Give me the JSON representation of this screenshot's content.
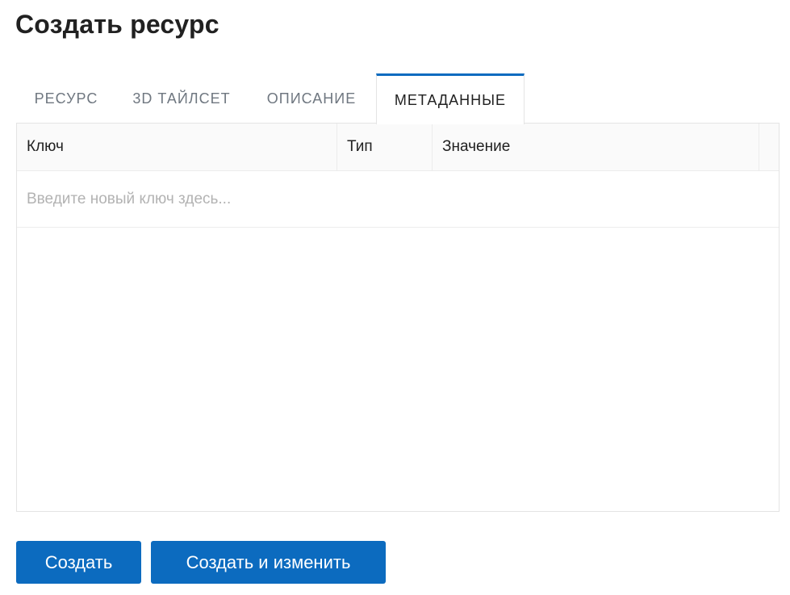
{
  "page": {
    "title": "Создать ресурс"
  },
  "tabs": [
    {
      "label": "РЕСУРС",
      "active": false
    },
    {
      "label": "3D ТАЙЛСЕТ",
      "active": false
    },
    {
      "label": "ОПИСАНИЕ",
      "active": false
    },
    {
      "label": "МЕТАДАННЫЕ",
      "active": true
    }
  ],
  "metadata_table": {
    "columns": [
      "Ключ",
      "Тип",
      "Значение"
    ],
    "new_key_placeholder": "Введите новый ключ здесь..."
  },
  "actions": {
    "create_label": "Создать",
    "create_and_edit_label": "Создать и изменить"
  },
  "colors": {
    "accent": "#0c6bbf",
    "border": "#e4e4e4",
    "text": "#212121",
    "muted": "#6f7780"
  }
}
